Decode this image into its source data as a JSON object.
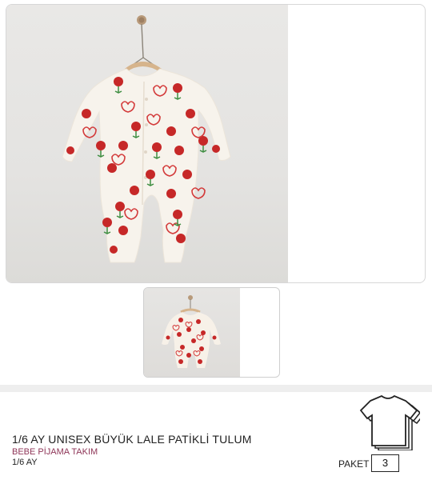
{
  "gallery": {
    "main_image_icon": "baby-onesie-red-tulip-pattern-photo",
    "thumbnail_icon": "baby-onesie-red-heart-pattern-photo"
  },
  "product": {
    "title": "1/6 AY UNISEX BÜYÜK LALE PATİKLİ TULUM",
    "category": "BEBE PİJAMA TAKIM",
    "size": "1/6 AY"
  },
  "package": {
    "label": "PAKET",
    "quantity": "3",
    "icon": "tshirt-stack-icon"
  },
  "colors": {
    "category_text": "#8e3557",
    "print_red": "#c62828"
  }
}
